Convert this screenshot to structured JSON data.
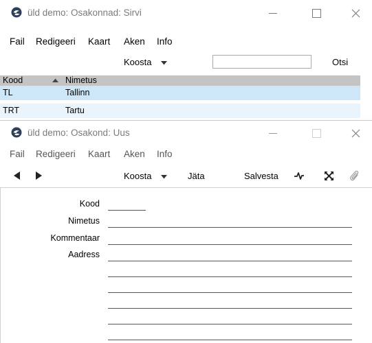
{
  "window1": {
    "title": "üld demo: Osakonnad: Sirvi",
    "menu": [
      "Fail",
      "Redigeeri",
      "Kaart",
      "Aken",
      "Info"
    ],
    "toolbar": {
      "create_label": "Koosta",
      "search_value": "",
      "search_label": "Otsi"
    },
    "table": {
      "columns": [
        "Kood",
        "Nimetus"
      ],
      "rows": [
        {
          "code": "TL",
          "name": "Tallinn"
        },
        {
          "code": "TRT",
          "name": "Tartu"
        }
      ]
    }
  },
  "window2": {
    "title": "üld demo: Osakond: Uus",
    "menu": [
      "Fail",
      "Redigeeri",
      "Kaart",
      "Aken",
      "Info"
    ],
    "toolbar": {
      "create_label": "Koosta",
      "cancel_label": "Jäta",
      "save_label": "Salvesta"
    },
    "form": {
      "code_label": "Kood",
      "name_label": "Nimetus",
      "comment_label": "Kommentaar",
      "address_label": "Aadress"
    }
  }
}
